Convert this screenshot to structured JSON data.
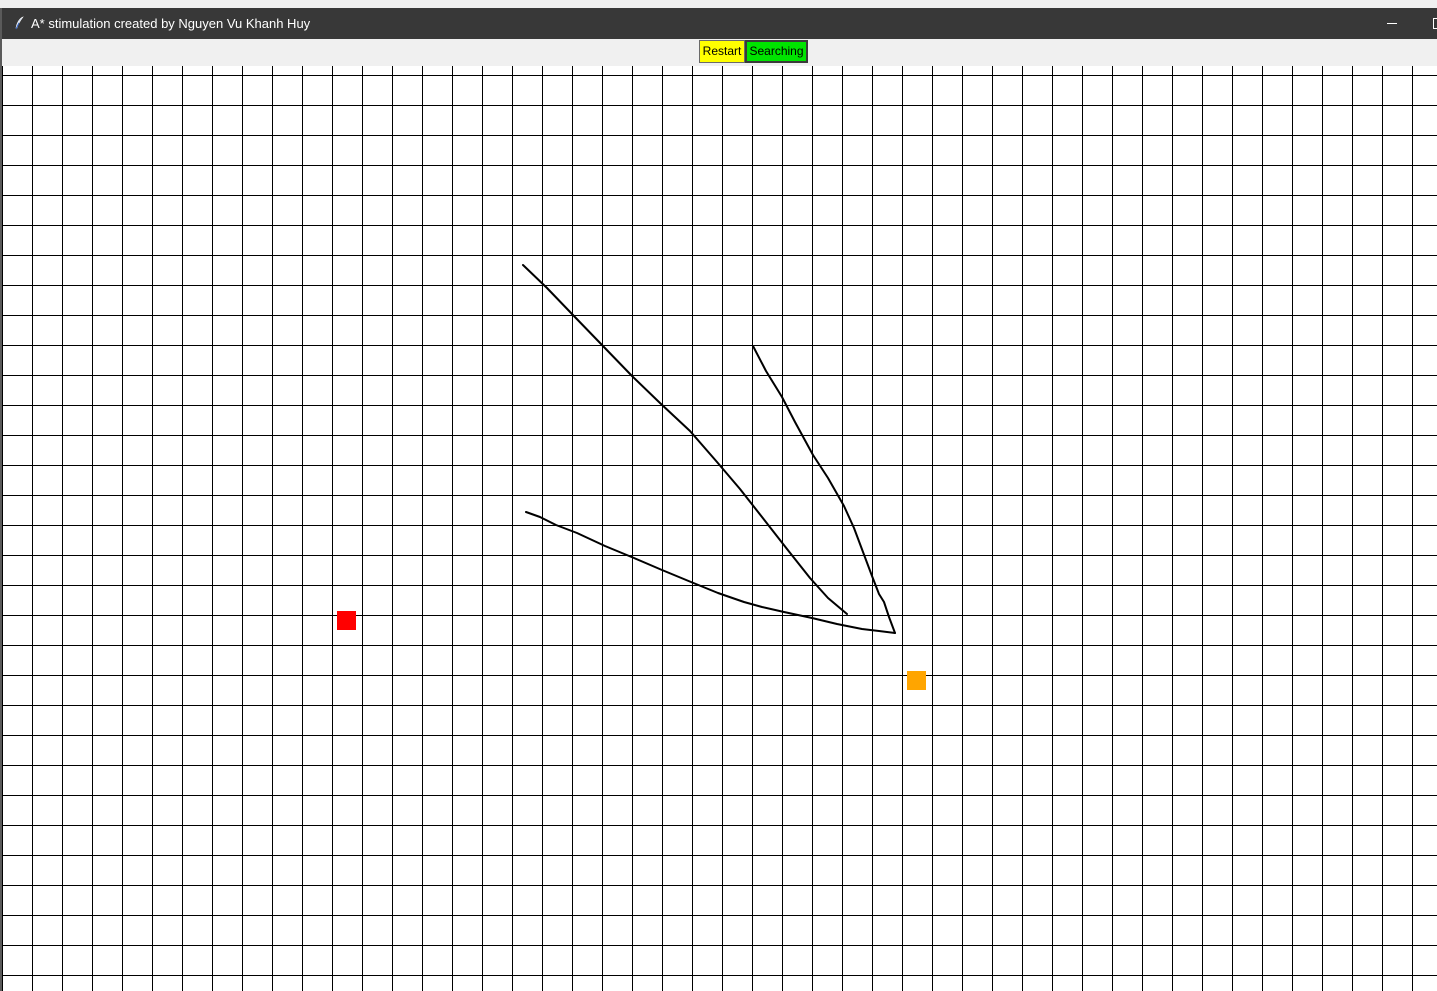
{
  "window": {
    "title": "A* stimulation created by Nguyen Vu Khanh Huy",
    "icon": "feather-icon",
    "titlebar_color": "#383838"
  },
  "toolbar": {
    "restart_label": "Restart",
    "restart_color": "#ffff00",
    "searching_label": "Searching",
    "searching_color": "#00e400"
  },
  "grid": {
    "cell_color": "#ffffff",
    "line_color": "#000000",
    "start_node_color": "#ff0000",
    "end_node_color": "#ffa500"
  }
}
